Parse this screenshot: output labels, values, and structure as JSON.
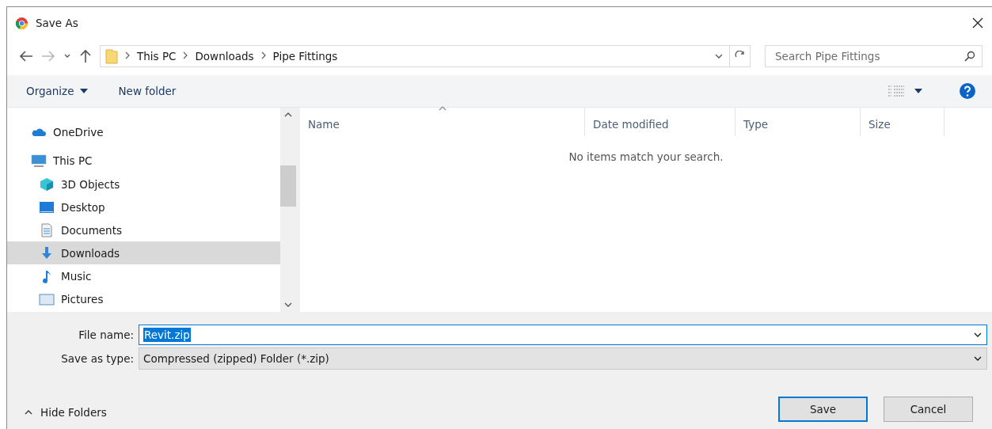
{
  "window": {
    "title": "Save As"
  },
  "address_bar": {
    "crumbs": [
      "This PC",
      "Downloads",
      "Pipe Fittings"
    ]
  },
  "search": {
    "placeholder": "Search Pipe Fittings"
  },
  "toolbar": {
    "organize": "Organize",
    "new_folder": "New folder"
  },
  "nav_items": [
    {
      "label": "OneDrive",
      "kind": "cloud",
      "group": true,
      "selected": false
    },
    {
      "label": "This PC",
      "kind": "pc",
      "group": true,
      "selected": false
    },
    {
      "label": "3D Objects",
      "kind": "cube",
      "group": false,
      "selected": false
    },
    {
      "label": "Desktop",
      "kind": "desktop",
      "group": false,
      "selected": false
    },
    {
      "label": "Documents",
      "kind": "document",
      "group": false,
      "selected": false
    },
    {
      "label": "Downloads",
      "kind": "download",
      "group": false,
      "selected": true
    },
    {
      "label": "Music",
      "kind": "music",
      "group": false,
      "selected": false
    },
    {
      "label": "Pictures",
      "kind": "pictures",
      "group": false,
      "selected": false
    }
  ],
  "file_list": {
    "columns": [
      {
        "label": "Name",
        "sorted": true
      },
      {
        "label": "Date modified",
        "sorted": false
      },
      {
        "label": "Type",
        "sorted": false
      },
      {
        "label": "Size",
        "sorted": false
      }
    ],
    "empty_message": "No items match your search."
  },
  "file_name": {
    "label": "File name:",
    "value": "Revit.zip",
    "selected": true
  },
  "save_as_type": {
    "label": "Save as type:",
    "value": "Compressed (zipped) Folder (*.zip)"
  },
  "hide_folders": "Hide Folders",
  "buttons": [
    {
      "label": "Save",
      "default": true
    },
    {
      "label": "Cancel",
      "default": false
    }
  ]
}
